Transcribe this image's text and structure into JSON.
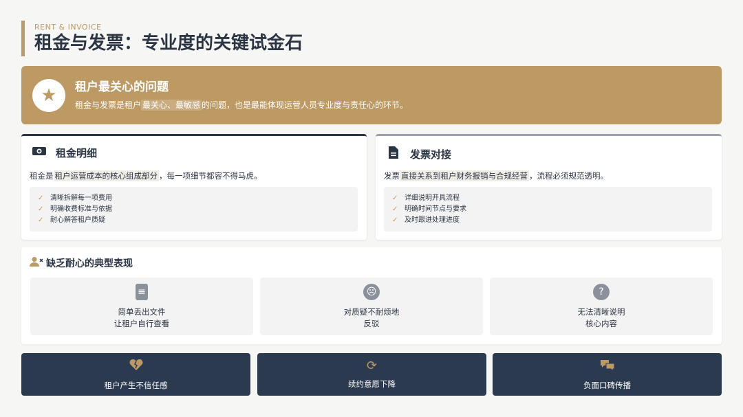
{
  "header": {
    "eyebrow": "RENT & INVOICE",
    "title": "租金与发票：专业度的关键试金石"
  },
  "banner": {
    "icon": "star-icon",
    "title": "租户最关心的问题",
    "text_before": "租金与发票是租户",
    "text_highlight": "最关心、最敏感",
    "text_after": "的问题，也是最能体现运营人员专业度与责任心的环节。"
  },
  "rent_card": {
    "icon": "money-icon",
    "title": "租金明细",
    "desc_before": "租金是",
    "desc_highlight": "租户运营成本的核心组成部分",
    "desc_after": "，每一项细节都容不得马虎。",
    "items": [
      "清晰拆解每一项费用",
      "明确收费标准与依据",
      "耐心解答租户质疑"
    ]
  },
  "invoice_card": {
    "icon": "document-icon",
    "title": "发票对接",
    "desc_before": "发票",
    "desc_highlight": "直接关系到租户财务报销与合规经营",
    "desc_after": "，流程必须规范透明。",
    "items": [
      "详细说明开具流程",
      "明确时间节点与要求",
      "及时跟进处理进度"
    ]
  },
  "impatience": {
    "icon": "user-x-icon",
    "title": "缺乏耐心的典型表现",
    "symptoms": [
      {
        "icon": "file-icon",
        "line1": "简单丢出文件",
        "line2": "让租户自行查看"
      },
      {
        "icon": "angry-face-icon",
        "line1": "对质疑不耐烦地",
        "line2": "反驳"
      },
      {
        "icon": "question-icon",
        "line1": "无法清晰说明",
        "line2": "核心内容"
      }
    ]
  },
  "consequences": [
    {
      "icon": "broken-heart-icon",
      "label": "租户产生不信任感"
    },
    {
      "icon": "refresh-icon",
      "label": "续约意愿下降"
    },
    {
      "icon": "comments-icon",
      "label": "负面口碑传播"
    }
  ],
  "colors": {
    "accent": "#bd9a63",
    "navy": "#2c3a4f",
    "background": "#f6f6f4"
  }
}
